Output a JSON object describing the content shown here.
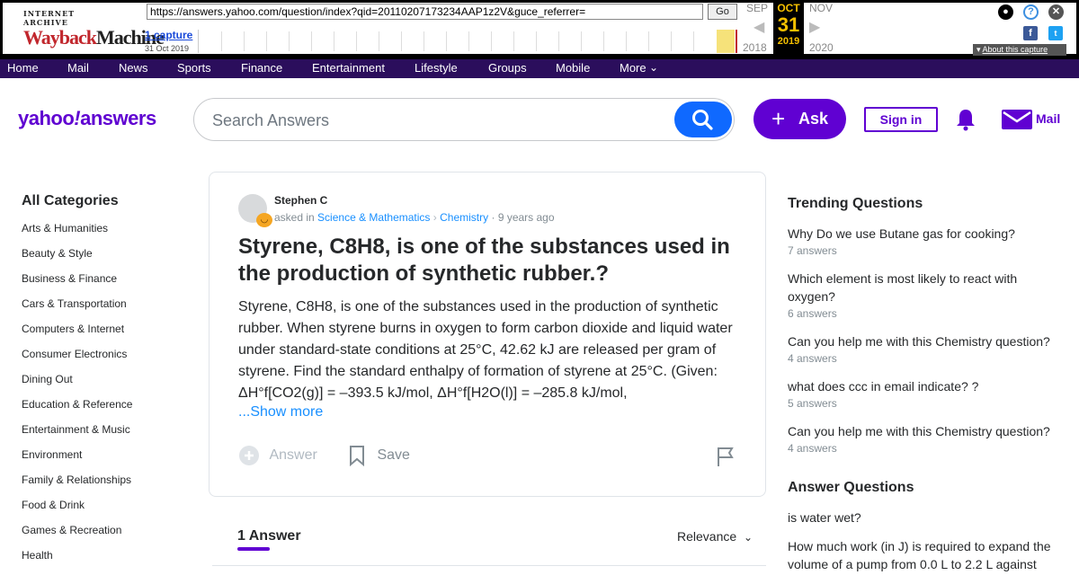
{
  "wayback": {
    "logo_top": "INTERNET ARCHIVE",
    "logo_wayback": "Wayback",
    "logo_machine": "Machine",
    "url": "https://answers.yahoo.com/question/index?qid=20110207173234AAP1z2V&guce_referrer=",
    "go_label": "Go",
    "captures": "1 capture",
    "capture_date": "31 Oct 2019",
    "prev_month": "SEP",
    "cur_month": "OCT",
    "next_month": "NOV",
    "cur_day": "31",
    "prev_year": "2018",
    "cur_year": "2019",
    "next_year": "2020",
    "about": "About this capture"
  },
  "nav": {
    "items": [
      "Home",
      "Mail",
      "News",
      "Sports",
      "Finance",
      "Entertainment",
      "Lifestyle",
      "Groups",
      "Mobile",
      "More"
    ]
  },
  "header": {
    "logo_yahoo": "yahoo",
    "logo_bang": "!",
    "logo_answers": "answers",
    "search_placeholder": "Search Answers",
    "ask_label": "Ask",
    "signin_label": "Sign in",
    "mail_label": "Mail"
  },
  "categories": {
    "title": "All Categories",
    "items": [
      "Arts & Humanities",
      "Beauty & Style",
      "Business & Finance",
      "Cars & Transportation",
      "Computers & Internet",
      "Consumer Electronics",
      "Dining Out",
      "Education & Reference",
      "Entertainment & Music",
      "Environment",
      "Family & Relationships",
      "Food & Drink",
      "Games & Recreation",
      "Health"
    ]
  },
  "question": {
    "author": "Stephen C",
    "asked_in": "asked in",
    "category": "Science & Mathematics",
    "subcategory": "Chemistry",
    "age": "· 9 years ago",
    "title": "Styrene, C8H8, is one of the substances used in the production of synthetic rubber.?",
    "body": "Styrene, C8H8, is one of the substances used in the production of synthetic rubber. When styrene burns in oxygen to form carbon dioxide and liquid water under standard-state conditions at 25°C, 42.62 kJ are released per gram of styrene. Find the standard enthalpy of formation of styrene at 25°C. (Given: ΔH°f[CO2(g)] = –393.5 kJ/mol, ΔH°f[H2O(l)] = –285.8 kJ/mol,",
    "show_more": "...Show more",
    "answer_label": "Answer",
    "save_label": "Save"
  },
  "answers": {
    "count_label": "1 Answer",
    "sort_label": "Relevance"
  },
  "trending": {
    "title": "Trending Questions",
    "items": [
      {
        "q": "Why Do we use Butane gas for cooking?",
        "n": "7 answers"
      },
      {
        "q": "Which element is most likely to react with oxygen?",
        "n": "6 answers"
      },
      {
        "q": "Can you help me with this Chemistry question?",
        "n": "4 answers"
      },
      {
        "q": "what does ccc in email indicate? ?",
        "n": "5 answers"
      },
      {
        "q": "Can you help me with this Chemistry question?",
        "n": "4 answers"
      }
    ]
  },
  "answer_questions": {
    "title": "Answer Questions",
    "items": [
      "is water wet?",
      "How much work (in J) is required to expand the volume of a pump from 0.0 L to 2.2 L against"
    ]
  }
}
